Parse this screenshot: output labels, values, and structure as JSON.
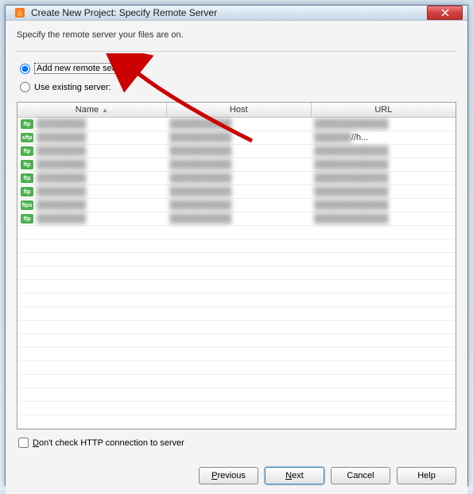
{
  "titlebar": {
    "title": "Create New Project: Specify Remote Server"
  },
  "instruction": "Specify the remote server your files are on.",
  "radios": {
    "add_new": "Add new remote server",
    "use_existing": "Use existing server:"
  },
  "table": {
    "headers": {
      "name": "Name",
      "host": "Host",
      "url": "URL"
    },
    "rows": [
      {
        "proto": "ftp",
        "name_blur": "████████",
        "host_blur": "██████████",
        "url_blur": "████████████"
      },
      {
        "proto": "sftp",
        "name_blur": "████████",
        "host_blur": "██████████",
        "url_text": "//h..."
      },
      {
        "proto": "ftp",
        "name_blur": "████████",
        "host_blur": "██████████",
        "url_blur": "████████████"
      },
      {
        "proto": "ftp",
        "name_blur": "████████",
        "host_blur": "██████████",
        "url_blur": "████████████"
      },
      {
        "proto": "ftp",
        "name_blur": "████████",
        "host_blur": "██████████",
        "url_blur": "████████████"
      },
      {
        "proto": "ftp",
        "name_blur": "████████",
        "host_blur": "██████████",
        "url_blur": "████████████"
      },
      {
        "proto": "ftps",
        "name_blur": "████████",
        "host_blur": "██████████",
        "url_blur": "████████████"
      },
      {
        "proto": "ftp",
        "name_blur": "████████",
        "host_blur": "██████████",
        "url_blur": "████████████"
      }
    ]
  },
  "checkbox": {
    "dont_check_http": "Don't check HTTP connection to server"
  },
  "buttons": {
    "previous": "Previous",
    "next": "Next",
    "cancel": "Cancel",
    "help": "Help"
  }
}
